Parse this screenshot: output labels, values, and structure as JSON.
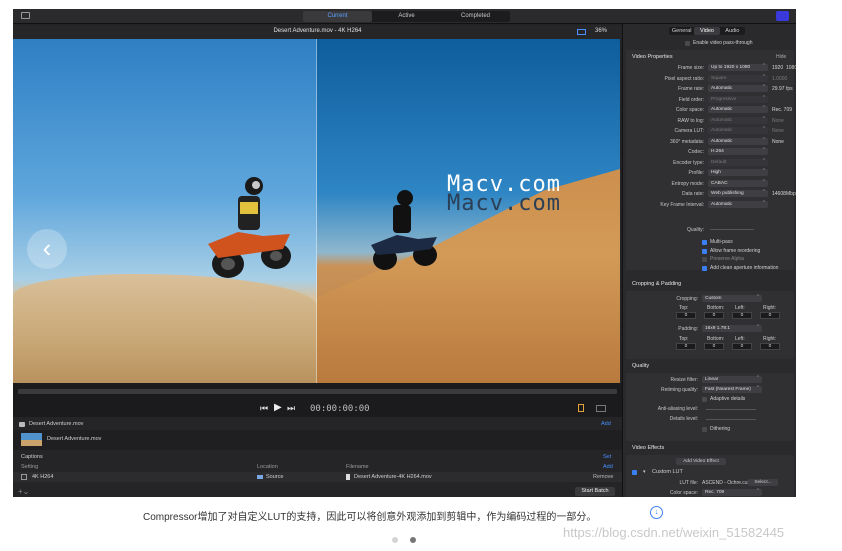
{
  "window": {
    "tabs": [
      {
        "label": "Current",
        "active": true
      },
      {
        "label": "Active",
        "active": false
      },
      {
        "label": "Completed",
        "active": false
      }
    ]
  },
  "viewer": {
    "title": "Desert Adventure.mov - 4K H264",
    "zoom": "36%",
    "timecode": "00:00:00:00",
    "watermark": "Macv.com"
  },
  "batch": {
    "source_file": "Desert Adventure.mov",
    "item_title": "Desert Adventure.mov",
    "add_label": "Add",
    "captions_label": "Captions",
    "set_label": "Set",
    "columns": [
      "Setting",
      "Location",
      "Filename"
    ],
    "add_col_label": "Add",
    "job": {
      "setting": "4K H264",
      "location": "Source",
      "filename": "Desert Adventure-4K H264.mov",
      "remove": "Remove"
    },
    "start_batch": "Start Batch"
  },
  "inspector": {
    "tabs": [
      {
        "label": "General",
        "active": false
      },
      {
        "label": "Video",
        "active": true
      },
      {
        "label": "Audio",
        "active": false
      }
    ],
    "passthrough": "Enable video pass-through",
    "video_properties": {
      "title": "Video Properties",
      "hide": "Hide",
      "rows": [
        {
          "label": "Frame size:",
          "value": "Up to 1920 x 1080",
          "extra": "1920",
          "extra2": "1080",
          "dim": false
        },
        {
          "label": "Pixel aspect ratio:",
          "value": "Square",
          "extra": "1.0000",
          "dim": true
        },
        {
          "label": "Frame rate:",
          "value": "Automatic",
          "extra": "29.97",
          "unit": "fps",
          "dim": false
        },
        {
          "label": "Field order:",
          "value": "Progressive",
          "extra": "",
          "dim": true
        },
        {
          "label": "Color space:",
          "value": "Automatic",
          "extra": "Rec. 709",
          "dim": false
        },
        {
          "label": "RAW to log:",
          "value": "Automatic",
          "extra": "None",
          "dim": true
        },
        {
          "label": "Camera LUT:",
          "value": "Automatic",
          "extra": "None",
          "dim": true
        },
        {
          "label": "360° metadata:",
          "value": "Automatic",
          "extra": "None",
          "dim": false
        },
        {
          "label": "Codec:",
          "value": "H.264",
          "extra": "",
          "dim": false
        },
        {
          "label": "Encoder type:",
          "value": "Default",
          "extra": "",
          "dim": true
        },
        {
          "label": "Profile:",
          "value": "High",
          "extra": "",
          "dim": false
        },
        {
          "label": "Entropy mode:",
          "value": "CABAC",
          "extra": "",
          "dim": false
        },
        {
          "label": "Data rate:",
          "value": "Web publishing",
          "extra": "14608",
          "unit": "Mbps",
          "dim": false
        },
        {
          "label": "Key Frame Interval:",
          "value": "Automatic",
          "extra": "",
          "dim": false
        }
      ],
      "quality_label": "Quality:",
      "checks": [
        {
          "label": "Multi-pass",
          "on": true
        },
        {
          "label": "Allow frame reordering",
          "on": true
        },
        {
          "label": "Preserve Alpha",
          "on": false
        },
        {
          "label": "Add clean aperture information",
          "on": true
        }
      ]
    },
    "cropping": {
      "title": "Cropping & Padding",
      "cropping_label": "Cropping:",
      "cropping_value": "Custom",
      "padding_label": "Padding:",
      "padding_value": "16x9 1.78:1",
      "edges": [
        "Top:",
        "Bottom:",
        "Left:",
        "Right:"
      ],
      "crop_vals": [
        "0",
        "0",
        "0",
        "0"
      ],
      "pad_vals": [
        "0",
        "0",
        "0",
        "0"
      ]
    },
    "quality": {
      "title": "Quality",
      "resize_label": "Resize filter:",
      "resize_value": "Linear",
      "retiming_label": "Retiming quality:",
      "retiming_value": "Fast (Nearest Frame)",
      "adaptive": "Adaptive details",
      "anti_alias": "Anti-aliasing level:",
      "details": "Details level:",
      "dithering": "Dithering"
    },
    "effects": {
      "title": "Video Effects",
      "add_effect": "Add Video Effect",
      "custom_lut": "Custom LUT",
      "lut_file_label": "LUT file:",
      "lut_file": "ASCEND - Ochre.cube",
      "select": "Select...",
      "color_space_label": "Color space:",
      "color_space": "Rec. 709"
    }
  },
  "page": {
    "caption": "Compressor增加了对自定义LUT的支持，因此可以将创意外观添加到剪辑中，作为编码过程的一部分。",
    "csdn": "https://blog.csdn.net/weixin_51582445",
    "accent": "#3b7ff5"
  }
}
